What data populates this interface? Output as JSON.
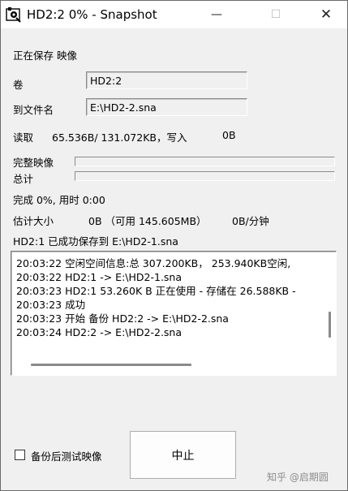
{
  "window": {
    "title": "HD2:2 0% - Snapshot",
    "minimize_glyph": "—",
    "maximize_glyph": "☐",
    "close_glyph": "✕"
  },
  "status": {
    "heading": "正在保存 映像",
    "volume_label": "卷",
    "volume_value": "HD2:2",
    "file_label": "到文件名",
    "file_value": "E:\\HD2-2.sna",
    "read_label": "读取",
    "read_value": "65.536B/ 131.072KB，写入",
    "write_value": "0B"
  },
  "progress": {
    "image_label": "完整映像",
    "image_percent": 0,
    "total_label": "总计",
    "total_percent": 0,
    "done_text": "完成 0%, 用时 0:00",
    "estimate_label": "估计大小",
    "estimate_value": "0B （可用 145.605MB）",
    "rate_value": "0B/分钟"
  },
  "last_result": "HD2:1 已成功保存到 E:\\HD2-1.sna",
  "log": [
    "20:03:22 空闲空间信息:总 307.200KB， 253.940KB空闲,",
    "20:03:22 HD2:1 -> E:\\HD2-1.sna",
    "20:03:23 HD2:1  53.260K B 正在使用 - 存储在  26.588KB -",
    "20:03:23 成功",
    "20:03:23 开始 备份 HD2:2 -> E:\\HD2-2.sna",
    "20:03:24 HD2:2 -> E:\\HD2-2.sna"
  ],
  "footer": {
    "verify_label": "备份后测试映像",
    "verify_checked": false,
    "stop_label": "中止",
    "watermark": "知乎 @启期圆"
  },
  "colors": {
    "progress_fill": "#06b025",
    "window_bg": "#f0f0f0"
  }
}
